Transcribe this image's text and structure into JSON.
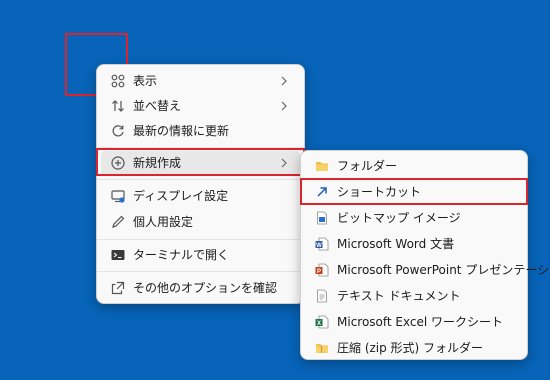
{
  "context_menu": {
    "items": [
      {
        "label": "表示",
        "icon": "view-grid-icon"
      },
      {
        "label": "並べ替え",
        "icon": "sort-icon"
      },
      {
        "label": "最新の情報に更新",
        "icon": "refresh-icon"
      },
      {
        "label": "新規作成",
        "icon": "new-plus-icon"
      },
      {
        "label": "ディスプレイ設定",
        "icon": "display-settings-icon"
      },
      {
        "label": "個人用設定",
        "icon": "pen-icon"
      },
      {
        "label": "ターミナルで開く",
        "icon": "terminal-icon"
      },
      {
        "label": "その他のオプションを確認",
        "icon": "show-more-icon"
      }
    ]
  },
  "submenu": {
    "items": [
      {
        "label": "フォルダー",
        "icon": "folder-icon"
      },
      {
        "label": "ショートカット",
        "icon": "shortcut-arrow-icon"
      },
      {
        "label": "ビットマップ イメージ",
        "icon": "bitmap-icon"
      },
      {
        "label": "Microsoft Word 文書",
        "icon": "word-icon"
      },
      {
        "label": "Microsoft PowerPoint プレゼンテーション",
        "icon": "powerpoint-icon"
      },
      {
        "label": "テキスト ドキュメント",
        "icon": "text-document-icon"
      },
      {
        "label": "Microsoft Excel ワークシート",
        "icon": "excel-icon"
      },
      {
        "label": "圧縮 (zip 形式) フォルダー",
        "icon": "zip-folder-icon"
      }
    ]
  },
  "colors": {
    "desktop": "#0764b8",
    "highlight_border": "#d9262e"
  }
}
